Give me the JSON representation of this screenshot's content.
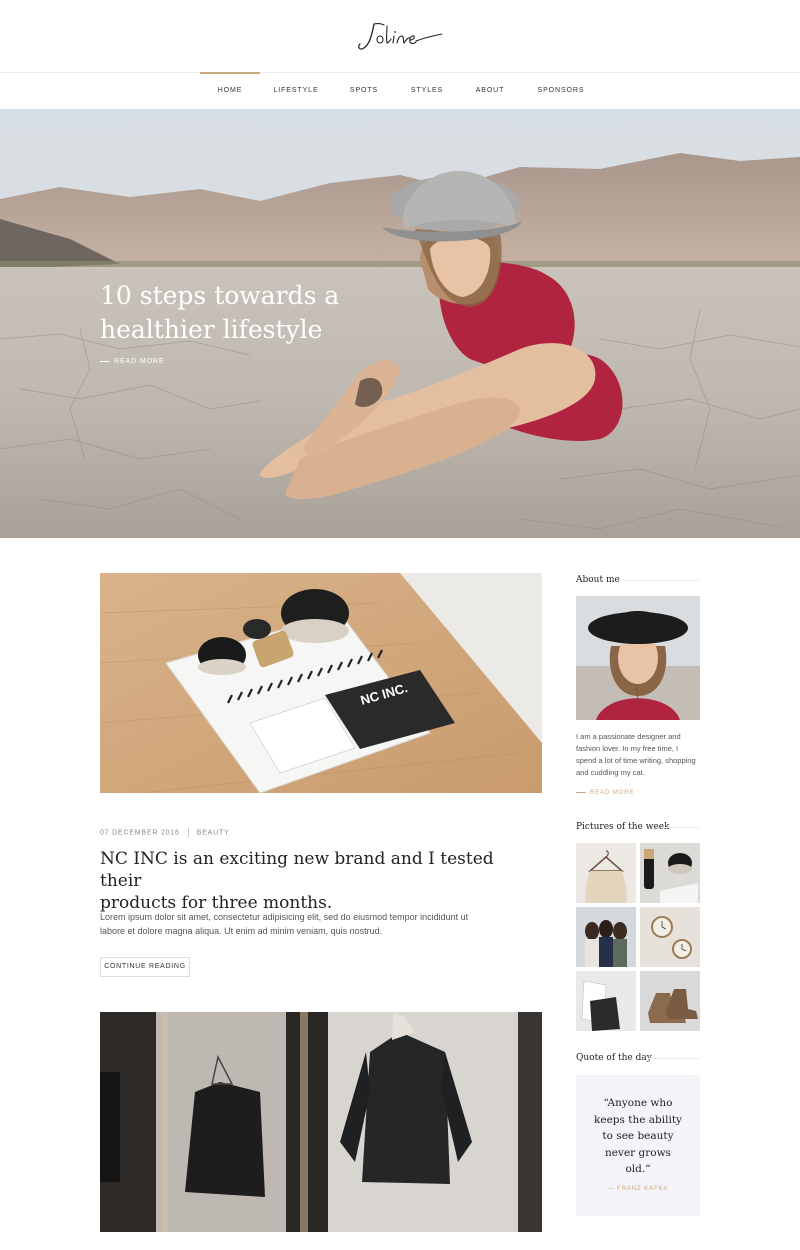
{
  "brand": {
    "logo_text": "Joline"
  },
  "nav": {
    "items": [
      {
        "label": "Home",
        "active": true
      },
      {
        "label": "Lifestyle",
        "active": false
      },
      {
        "label": "Spots",
        "active": false
      },
      {
        "label": "Styles",
        "active": false
      },
      {
        "label": "About",
        "active": false
      },
      {
        "label": "Sponsors",
        "active": false
      }
    ]
  },
  "hero": {
    "title_line1": "10 steps towards a",
    "title_line2": "healthier lifestyle",
    "read_more": "Read more"
  },
  "posts": [
    {
      "date": "07 December 2016",
      "category": "Beauty",
      "title_line1": "NC INC is an exciting new brand and I tested their",
      "title_line2": "products for three months.",
      "excerpt_line1": "Lorem ipsum dolor sit amet, consectetur adipisicing elit, sed do eiusmod tempor incididunt ut",
      "excerpt_line2": "labore et dolore magna aliqua. Ut enim ad minim veniam, quis nostrud.",
      "continue_label": "Continue reading",
      "image_logo": "NC INC."
    }
  ],
  "sidebar": {
    "about": {
      "title": "About me",
      "text_lines": [
        "I am a passionate designer and",
        "fashion lover. In my free time, I",
        "spend a lot of time writing, shopping",
        "and cuddling my cat."
      ],
      "read_more": "Read more"
    },
    "pictures": {
      "title": "Pictures of the week"
    },
    "quote": {
      "title": "Quote of the day",
      "lines": [
        "“Anyone who",
        "keeps the ability",
        "to see beauty",
        "never grows",
        "old.“"
      ],
      "author": "Franz Kafka"
    }
  },
  "colors": {
    "accent": "#c9a97c",
    "quote_bg": "#f4f4f8",
    "dress": "#b0243f"
  }
}
